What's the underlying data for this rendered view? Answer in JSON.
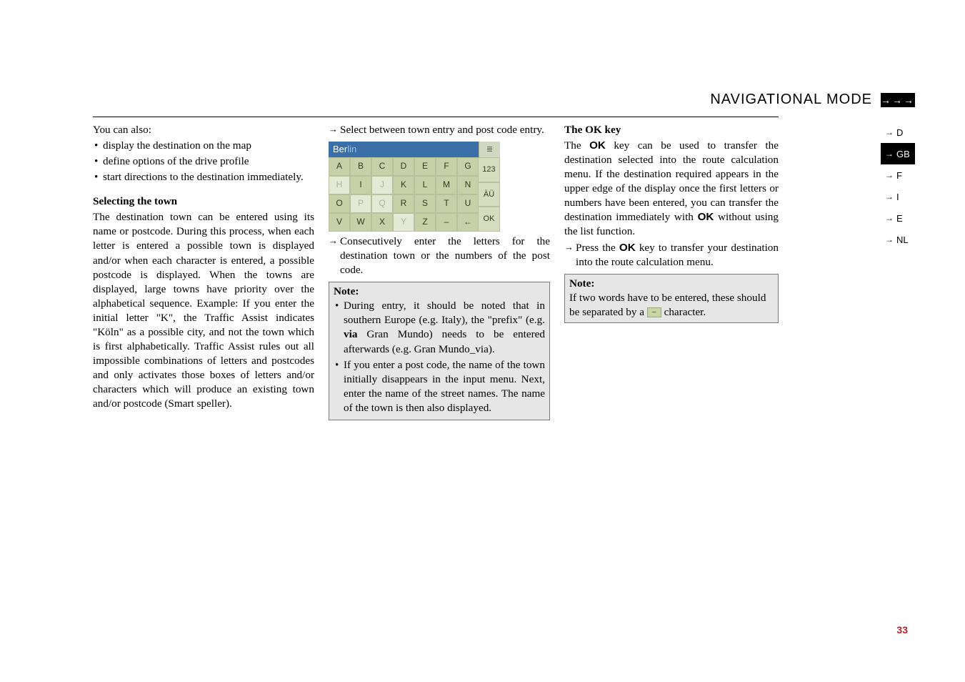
{
  "header": {
    "title": "NAVIGATIONAL MODE",
    "arrows": "→→→"
  },
  "col1": {
    "intro": "You can also:",
    "bullets": [
      "display the destination on the map",
      "define options of the drive profile",
      "start directions to the destination immediately."
    ],
    "subhead": "Selecting the town",
    "para": "The destination town can be entered using its name or postcode. During this process, when each letter is entered a possible town is displayed and/or when each character is entered, a possible postcode is displayed. When the towns are displayed, large towns have priority over the alphabetical sequence. Example: If you enter the initial letter \"K\", the Traffic Assist indicates \"Köln\" as a possible city, and not the town which is first alphabetically. Traffic Assist rules out all impossible combinations of letters and postcodes and only activates those boxes of letters and/or characters which will produce an existing town and/or postcode (Smart speller)."
  },
  "col2": {
    "step1": "Select between town entry and post code entry.",
    "keyboard": {
      "input_prefix": "Ber",
      "input_suffix": "lin",
      "list_icon": "≣",
      "rows": [
        [
          {
            "l": "A",
            "on": true
          },
          {
            "l": "B",
            "on": true
          },
          {
            "l": "C",
            "on": true
          },
          {
            "l": "D",
            "on": true
          },
          {
            "l": "E",
            "on": true
          },
          {
            "l": "F",
            "on": true
          },
          {
            "l": "G",
            "on": true
          }
        ],
        [
          {
            "l": "H",
            "on": false
          },
          {
            "l": "I",
            "on": true
          },
          {
            "l": "J",
            "on": false
          },
          {
            "l": "K",
            "on": true
          },
          {
            "l": "L",
            "on": true
          },
          {
            "l": "M",
            "on": true
          },
          {
            "l": "N",
            "on": true
          }
        ],
        [
          {
            "l": "O",
            "on": true
          },
          {
            "l": "P",
            "on": false
          },
          {
            "l": "Q",
            "on": false
          },
          {
            "l": "R",
            "on": true
          },
          {
            "l": "S",
            "on": true
          },
          {
            "l": "T",
            "on": true
          },
          {
            "l": "U",
            "on": true
          }
        ],
        [
          {
            "l": "V",
            "on": true
          },
          {
            "l": "W",
            "on": true
          },
          {
            "l": "X",
            "on": true
          },
          {
            "l": "Y",
            "on": false
          },
          {
            "l": "Z",
            "on": true
          },
          {
            "l": "–",
            "on": true
          },
          {
            "l": "←",
            "on": true
          }
        ]
      ],
      "side": [
        "123",
        "ÄÜ",
        "OK"
      ]
    },
    "step2": "Consecutively enter the letters for the destination town or the numbers of the post code.",
    "note_label": "Note:",
    "note_bullets": [
      "During entry, it should be noted that in southern Europe (e.g. Italy), the \"prefix\" (e.g. via Gran Mundo) needs to be entered afterwards (e.g. Gran Mundo_via).",
      "If you enter a post code, the name of the town initially disappears in the input menu. Next, enter the name of the street names. The name of the town is then also displayed."
    ],
    "via_bold": "via"
  },
  "col3": {
    "subhead": "The OK key",
    "para1a": "The ",
    "ok1": "OK",
    "para1b": " key can be used to transfer the destination selected into the route calculation menu. If the destination required appears in the upper edge of the display once the first letters or numbers have been entered, you can transfer the destination immediately with ",
    "ok2": "OK",
    "para1c": " without using the list function.",
    "step_a": "Press the ",
    "ok3": "OK",
    "step_b": " key to transfer your destination into the route calculation menu.",
    "note_label": "Note:",
    "note_text_a": "If two words have to be entered, these should be separated by a ",
    "note_text_b": " character.",
    "space_glyph": "–"
  },
  "tabs": [
    {
      "label": "D",
      "active": false
    },
    {
      "label": "GB",
      "active": true
    },
    {
      "label": "F",
      "active": false
    },
    {
      "label": "I",
      "active": false
    },
    {
      "label": "E",
      "active": false
    },
    {
      "label": "NL",
      "active": false
    }
  ],
  "page_number": "33"
}
